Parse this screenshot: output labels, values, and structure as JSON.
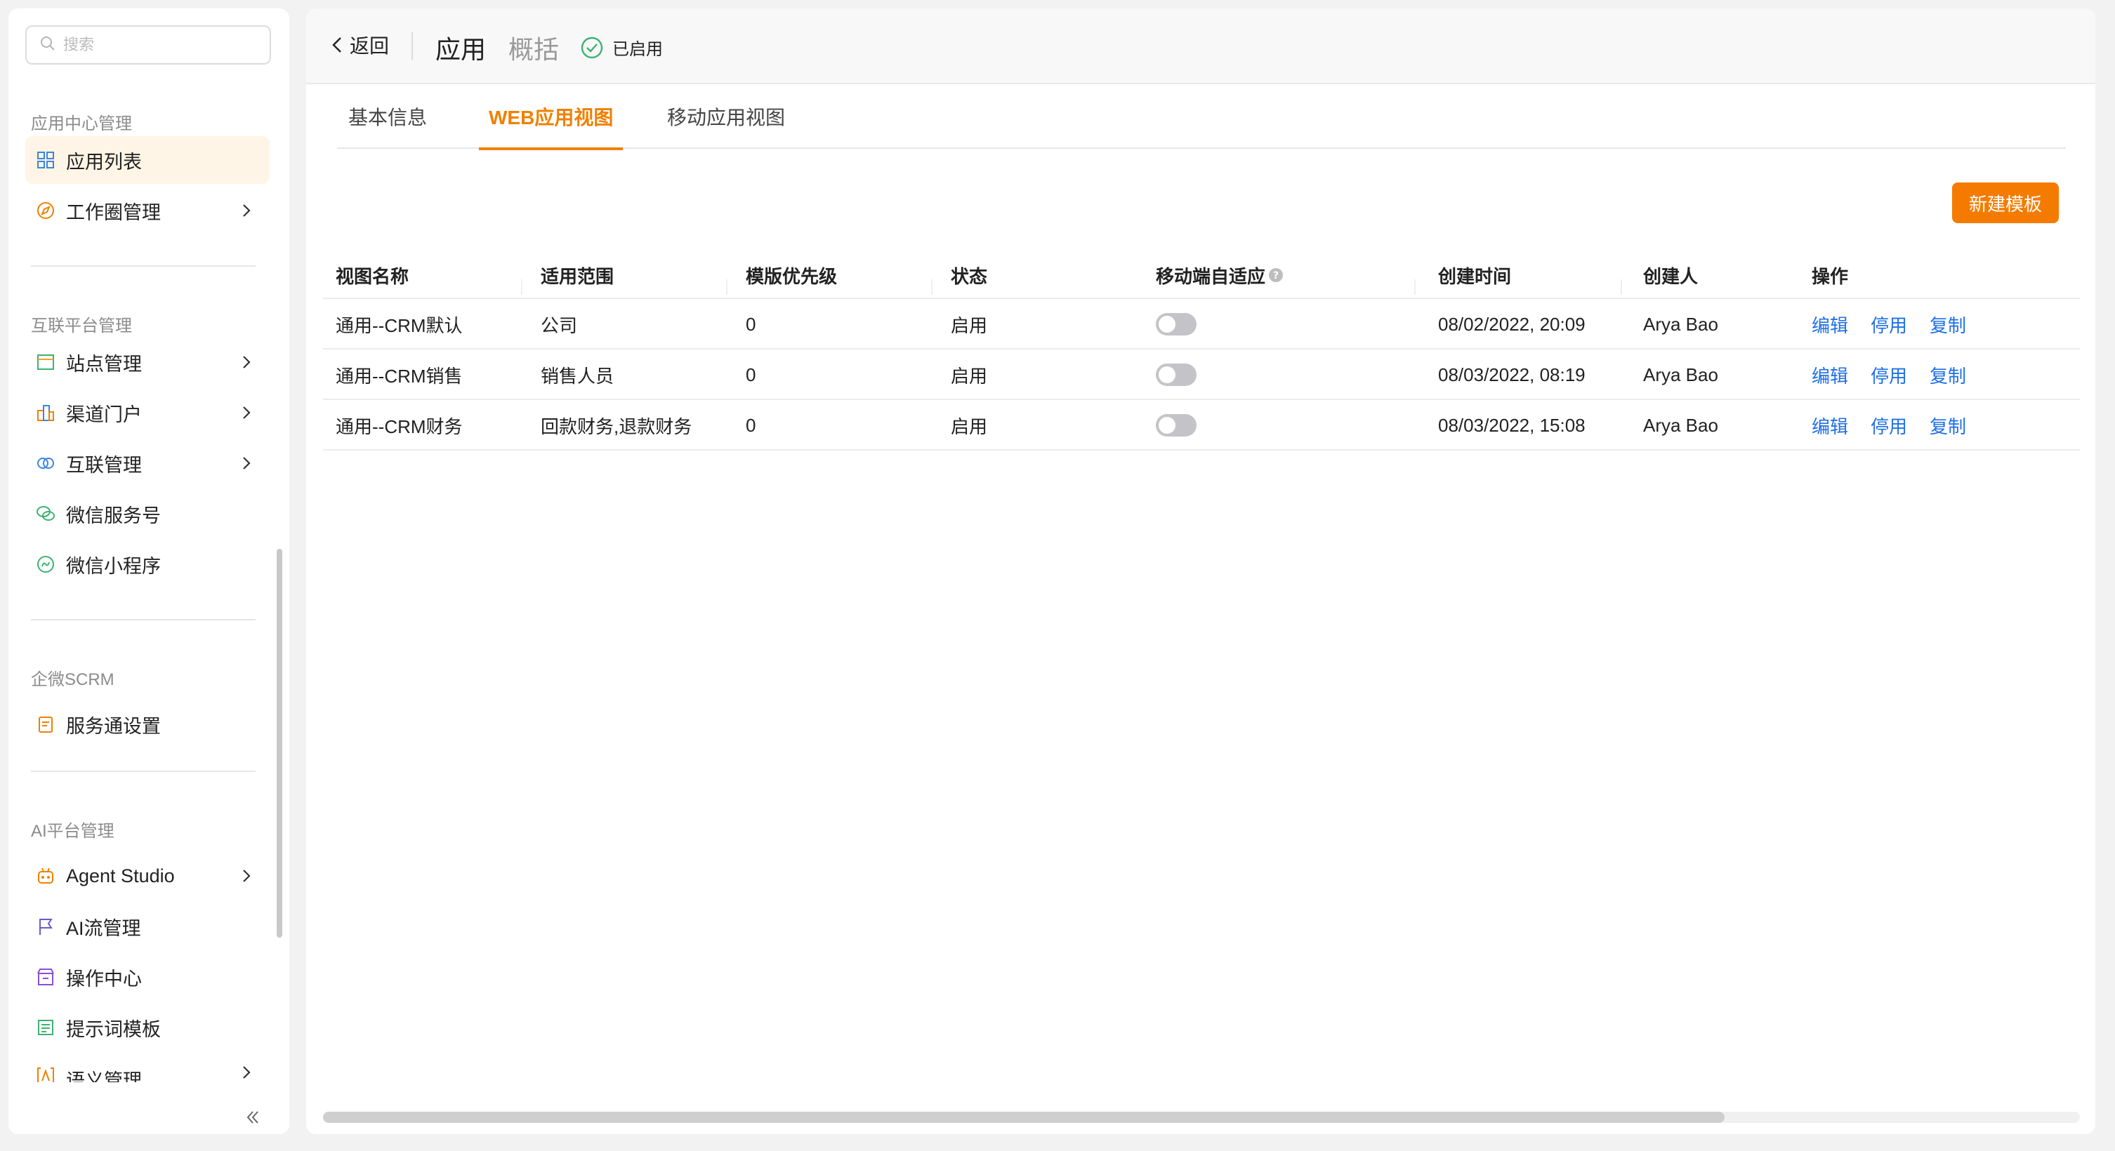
{
  "sidebar": {
    "search": {
      "placeholder": "搜索"
    },
    "sections": {
      "app_center": "应用中心管理",
      "interconnect": "互联平台管理",
      "scrm": "企微SCRM",
      "ai": "AI平台管理"
    },
    "items": {
      "app_list": "应用列表",
      "work_circle": "工作圈管理",
      "site_mgmt": "站点管理",
      "channel_portal": "渠道门户",
      "interconnect_mgmt": "互联管理",
      "wechat_service": "微信服务号",
      "wechat_mini": "微信小程序",
      "service_settings": "服务通设置",
      "agent_studio": "Agent Studio",
      "ai_flow": "AI流管理",
      "op_center": "操作中心",
      "prompt_template": "提示词模板",
      "semantic_mgmt": "语义管理"
    }
  },
  "header": {
    "back": "返回",
    "title": "应用",
    "subtitle": "概括",
    "status": "已启用"
  },
  "tabs": {
    "basic": "基本信息",
    "web": "WEB应用视图",
    "mobile": "移动应用视图"
  },
  "toolbar": {
    "new_template": "新建模板"
  },
  "table": {
    "columns": {
      "name": "视图名称",
      "scope": "适用范围",
      "priority": "模版优先级",
      "state": "状态",
      "mobile_adapt": "移动端自适应",
      "created_at": "创建时间",
      "creator": "创建人",
      "ops": "操作"
    },
    "rows": [
      {
        "name": "通用--CRM默认",
        "scope": "公司",
        "priority": "0",
        "state": "启用",
        "mobile_adapt": false,
        "created_at": "08/02/2022, 20:09",
        "creator": "Arya Bao"
      },
      {
        "name": "通用--CRM销售",
        "scope": "销售人员",
        "priority": "0",
        "state": "启用",
        "mobile_adapt": false,
        "created_at": "08/03/2022, 08:19",
        "creator": "Arya Bao"
      },
      {
        "name": "通用--CRM财务",
        "scope": "回款财务,退款财务",
        "priority": "0",
        "state": "启用",
        "mobile_adapt": false,
        "created_at": "08/03/2022, 15:08",
        "creator": "Arya Bao"
      }
    ],
    "actions": {
      "edit": "编辑",
      "disable": "停用",
      "copy": "复制"
    }
  },
  "colors": {
    "accent": "#f08000",
    "button": "#f47b00",
    "link": "#1e6fe8",
    "active_bg": "#fff5e6",
    "success": "#3cb371"
  }
}
